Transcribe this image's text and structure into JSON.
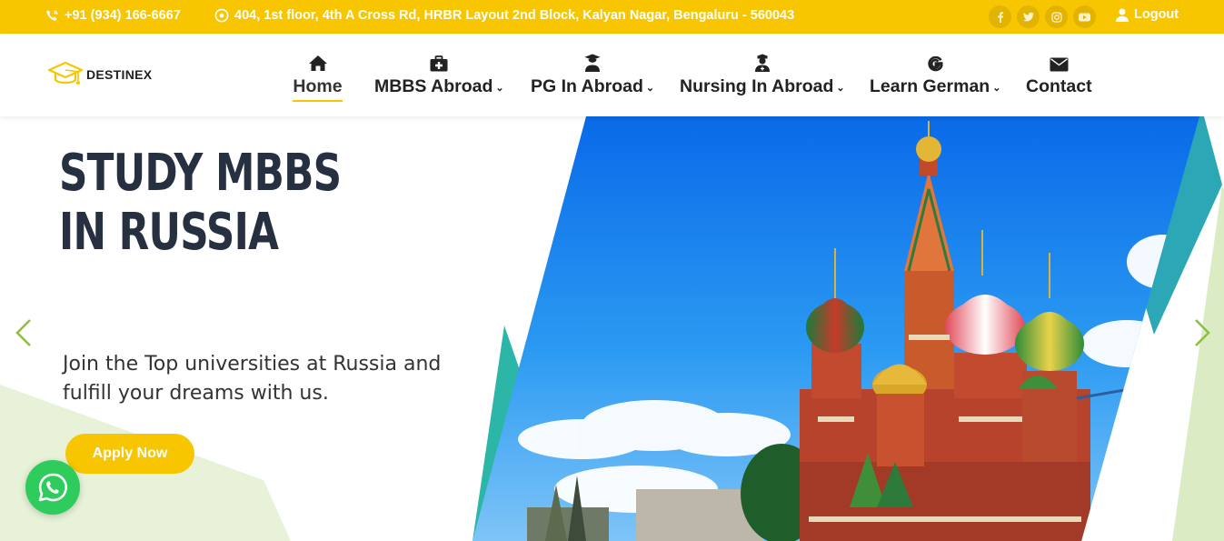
{
  "topbar": {
    "phone": "+91 (934) 166-6667",
    "address": "404, 1st floor, 4th A Cross Rd, HRBR Layout 2nd Block, Kalyan Nagar, Bengaluru - 560043",
    "social": [
      "facebook-icon",
      "twitter-icon",
      "instagram-icon",
      "youtube-icon"
    ],
    "logout": "Logout"
  },
  "brand": {
    "name": "DESTINEX"
  },
  "nav": {
    "items": [
      {
        "label": "Home",
        "icon": "home-icon",
        "active": true
      },
      {
        "label": "MBBS Abroad",
        "icon": "medkit-icon",
        "dropdown": true
      },
      {
        "label": "PG In Abroad",
        "icon": "graduate-icon",
        "dropdown": true
      },
      {
        "label": "Nursing In Abroad",
        "icon": "nurse-icon",
        "dropdown": true
      },
      {
        "label": "Learn German",
        "icon": "google-g-icon",
        "dropdown": true
      },
      {
        "label": "Contact",
        "icon": "envelope-icon"
      }
    ]
  },
  "hero": {
    "title_line1": "STUDY MBBS",
    "title_line2": "IN RUSSIA",
    "subtitle": "Join the Top universities at Russia and fulfill your dreams with us.",
    "cta": "Apply Now",
    "image": "st-basils-cathedral-photo"
  },
  "colors": {
    "accent": "#f7c600",
    "dark": "#263040",
    "teal": "#2bb6a8",
    "green": "#8cbf3f",
    "whatsapp": "#2ecc5c"
  }
}
